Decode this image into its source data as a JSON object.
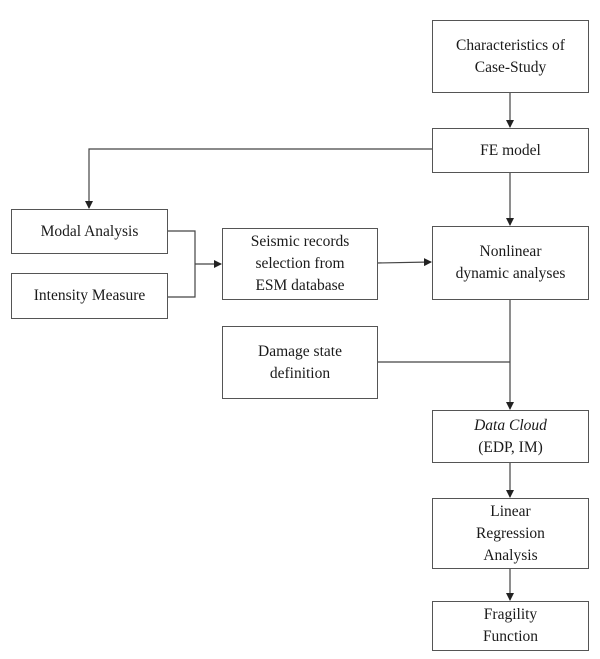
{
  "diagram": {
    "type": "flowchart",
    "nodes": {
      "case_study": {
        "lines": [
          "Characteristics of",
          "Case-Study"
        ]
      },
      "fe_model": {
        "lines": [
          "FE model"
        ]
      },
      "modal_analysis": {
        "lines": [
          "Modal Analysis"
        ]
      },
      "intensity_measure": {
        "lines": [
          "Intensity Measure"
        ]
      },
      "seismic_records": {
        "lines": [
          "Seismic records",
          "selection from",
          "ESM database"
        ]
      },
      "nonlinear": {
        "lines": [
          "Nonlinear",
          "dynamic analyses"
        ]
      },
      "damage_state": {
        "lines": [
          "Damage state",
          "definition"
        ]
      },
      "data_cloud": {
        "lines": [
          "Data Cloud",
          "(EDP, IM)"
        ]
      },
      "linear_regression": {
        "lines": [
          "Linear",
          "Regression",
          "Analysis"
        ]
      },
      "fragility": {
        "lines": [
          "Fragility",
          "Function"
        ]
      }
    },
    "edges": [
      {
        "from": "case_study",
        "to": "fe_model"
      },
      {
        "from": "fe_model",
        "to": "modal_analysis"
      },
      {
        "from": "fe_model",
        "to": "nonlinear"
      },
      {
        "from": "modal_analysis",
        "to": "seismic_records"
      },
      {
        "from": "intensity_measure",
        "to": "seismic_records"
      },
      {
        "from": "seismic_records",
        "to": "nonlinear"
      },
      {
        "from": "nonlinear",
        "to": "data_cloud"
      },
      {
        "from": "damage_state",
        "to": "data_cloud"
      },
      {
        "from": "data_cloud",
        "to": "linear_regression"
      },
      {
        "from": "linear_regression",
        "to": "fragility"
      }
    ]
  }
}
